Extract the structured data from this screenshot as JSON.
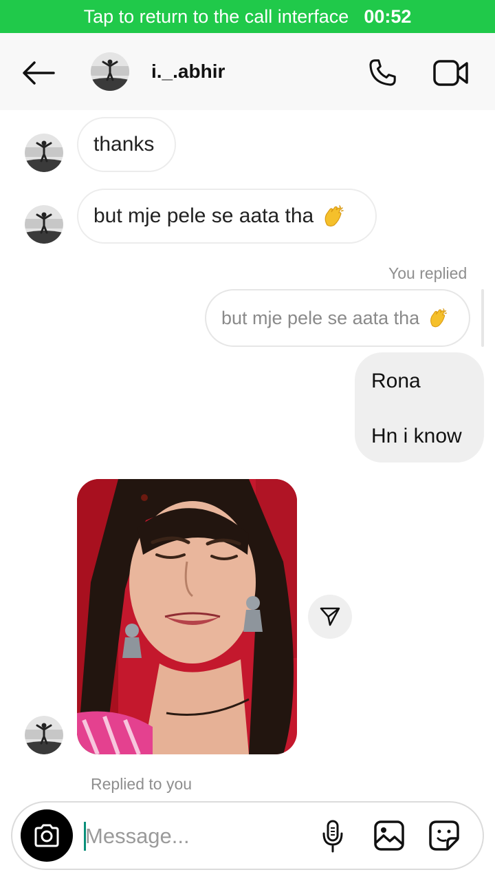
{
  "call_banner": {
    "text": "Tap to return to the call interface",
    "timer": "00:52"
  },
  "header": {
    "username": "i._.abhir"
  },
  "messages": [
    {
      "text": "thanks"
    },
    {
      "text": "but mje pele se aata tha"
    }
  ],
  "reply": {
    "label": "You replied",
    "quoted_text": "but mje pele se aata tha",
    "lines": [
      "Rona",
      "Hn i know"
    ]
  },
  "footer_label": "Replied to you",
  "composer": {
    "placeholder": "Message..."
  },
  "icons": {
    "back": "back-arrow-icon",
    "call": "phone-icon",
    "video": "video-camera-icon",
    "emoji": "clapping-hands-emoji",
    "share": "send-icon",
    "camera": "camera-icon",
    "mic": "microphone-icon",
    "gallery": "gallery-icon",
    "sticker": "sticker-icon"
  },
  "colors": {
    "call_banner": "#20c94a",
    "header_bg": "#f8f8f8",
    "outgoing_bubble": "#efefef",
    "cursor": "#0a8f7a"
  }
}
